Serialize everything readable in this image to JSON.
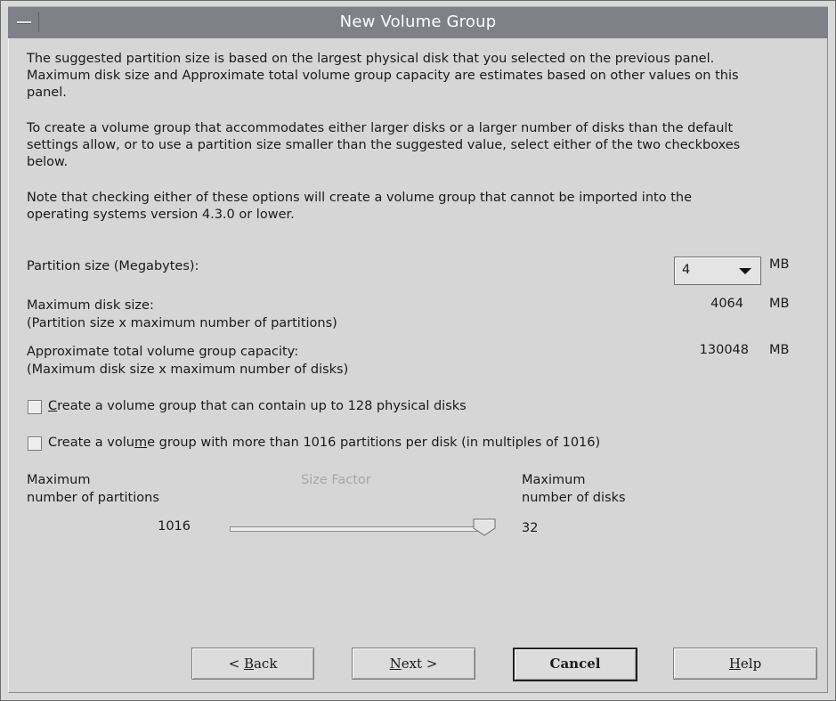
{
  "window": {
    "title": "New Volume Group"
  },
  "intro": {
    "p1": "The suggested partition size is based on the largest physical disk that you selected on the previous panel. Maximum disk size and Approximate total volume group capacity are estimates based on other values on this panel.",
    "p2": "To create a volume group that accommodates either larger disks or a larger number of disks than the default settings allow, or to use a partition size smaller than the suggested value, select either of the two checkboxes below.",
    "p3": "Note that checking either of these options will create a volume group that cannot be imported into the operating systems version 4.3.0 or lower."
  },
  "partition": {
    "label": "Partition size (Megabytes):",
    "value": "4",
    "unit": "MB"
  },
  "max_disk": {
    "label": "Maximum disk size:",
    "sub": "(Partition size x maximum number of partitions)",
    "value": "4064",
    "unit": "MB"
  },
  "capacity": {
    "label": "Approximate total volume group capacity:",
    "sub": "(Maximum disk size x maximum number of disks)",
    "value": "130048",
    "unit": "MB"
  },
  "checkbox1": {
    "mnemonic": "C",
    "rest": "reate a volume group that can contain up to 128 physical disks",
    "checked": false
  },
  "checkbox2": {
    "pre": "Create a volu",
    "mnemonic": "m",
    "post": "e group with more than 1016 partitions per disk (in multiples of 1016)",
    "checked": false
  },
  "size_factor": {
    "left_label_line1": "Maximum",
    "left_label_line2": "number of partitions",
    "center_label": "Size Factor",
    "right_label_line1": "Maximum",
    "right_label_line2": "number of disks",
    "partitions_value": "1016",
    "disks_value": "32",
    "slider_fraction": 1.0
  },
  "buttons": {
    "back": {
      "pre": "< ",
      "mnemonic": "B",
      "post": "ack"
    },
    "next": {
      "mnemonic": "N",
      "post": "ext >"
    },
    "cancel": "Cancel",
    "help": {
      "mnemonic": "H",
      "post": "elp"
    }
  },
  "colors": {
    "titlebar": "#7f8187",
    "background": "#d6d6d6",
    "disabled_text": "#a7a7a7"
  }
}
